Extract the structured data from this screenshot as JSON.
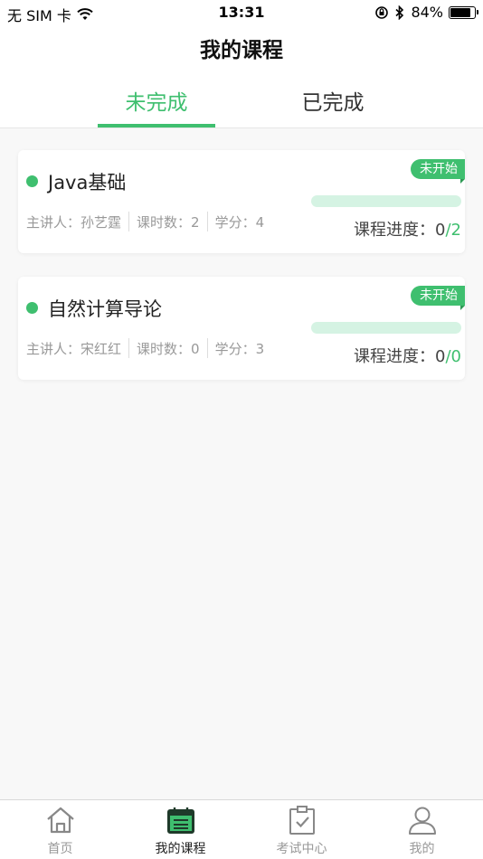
{
  "status_bar": {
    "carrier": "无 SIM 卡",
    "time": "13:31",
    "battery_percent": "84%",
    "battery_level": 0.84
  },
  "header": {
    "title": "我的课程"
  },
  "tabs": [
    {
      "label": "未完成",
      "active": true
    },
    {
      "label": "已完成",
      "active": false
    }
  ],
  "courses": [
    {
      "status": "未开始",
      "title": "Java基础",
      "lecturer": "主讲人：孙艺霆",
      "hours": "课时数：2",
      "credits": "学分：4",
      "progress_label": "课程进度：",
      "progress_done": "0",
      "progress_total": "2"
    },
    {
      "status": "未开始",
      "title": "自然计算导论",
      "lecturer": "主讲人：宋红红",
      "hours": "课时数：0",
      "credits": "学分：3",
      "progress_label": "课程进度：",
      "progress_done": "0",
      "progress_total": "0"
    }
  ],
  "tabbar": [
    {
      "label": "首页",
      "icon": "home-icon"
    },
    {
      "label": "我的课程",
      "icon": "calendar-icon",
      "active": true
    },
    {
      "label": "考试中心",
      "icon": "clipboard-check-icon"
    },
    {
      "label": "我的",
      "icon": "user-icon"
    }
  ],
  "colors": {
    "accent": "#3fbf6f",
    "track": "#d5f3e3"
  }
}
